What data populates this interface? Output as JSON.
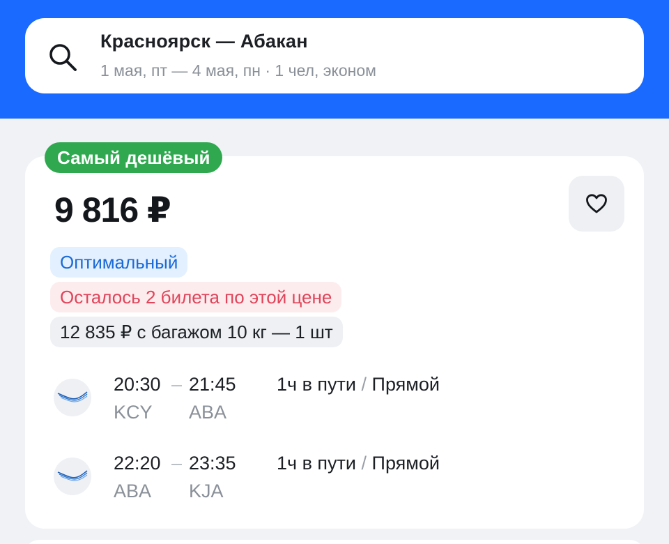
{
  "search": {
    "route": "Красноярск — Абакан",
    "details": "1 мая, пт — 4 мая, пн · 1 чел, эконом"
  },
  "offer": {
    "badge": "Самый дешёвый",
    "price": "9 816 ₽",
    "tags": {
      "optimal": "Оптимальный",
      "tickets_left": "Осталось 2 билета по этой цене",
      "baggage": "12 835 ₽ с багажом 10 кг — 1 шт"
    },
    "segments": [
      {
        "depart_time": "20:30",
        "arrive_time": "21:45",
        "from": "KCY",
        "to": "ABA",
        "duration": "1ч в пути",
        "separator": "/",
        "type": "Прямой"
      },
      {
        "depart_time": "22:20",
        "arrive_time": "23:35",
        "from": "ABA",
        "to": "KJA",
        "duration": "1ч в пути",
        "separator": "/",
        "type": "Прямой"
      }
    ]
  },
  "colors": {
    "header_blue": "#1a6aff",
    "cheapest_green": "#2fa84f",
    "optimal_blue": "#1a6ad6",
    "warning_red": "#e0445a"
  }
}
